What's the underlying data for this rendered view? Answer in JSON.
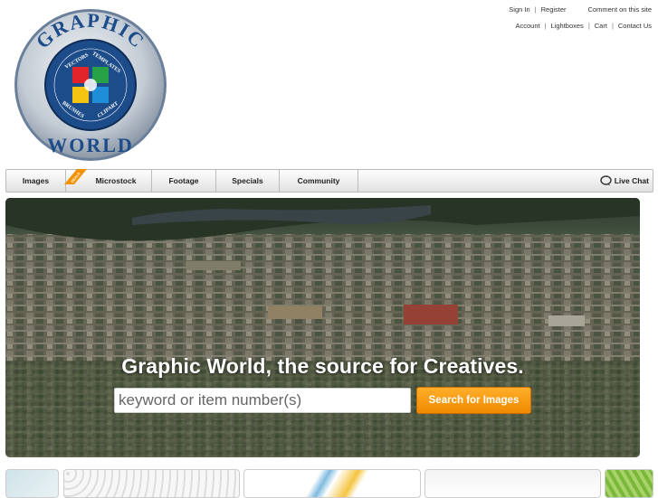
{
  "logo": {
    "top_text": "GRAPHIC",
    "bottom_text": "WORLD",
    "ring_words": [
      "VECTORS",
      "TEMPLATES",
      "BRUSHES",
      "CLIPART"
    ]
  },
  "top_links": {
    "row1": [
      "Sign In",
      "Register",
      "Comment on this site"
    ],
    "row2": [
      "Account",
      "Lightboxes",
      "Cart",
      "Contact Us"
    ]
  },
  "nav": {
    "items": [
      "Images",
      "Microstock",
      "Footage",
      "Specials",
      "Community"
    ],
    "badge_text": "DEALS FROM $1",
    "live_chat": "Live Chat"
  },
  "hero": {
    "title": "Graphic World, the source for Creatives.",
    "search_placeholder": "keyword or item number(s)",
    "search_button": "Search for Images"
  },
  "colors": {
    "accent": "#f39200",
    "nav_bg": "#eeeeee",
    "logo_blue": "#1c4f8c"
  }
}
